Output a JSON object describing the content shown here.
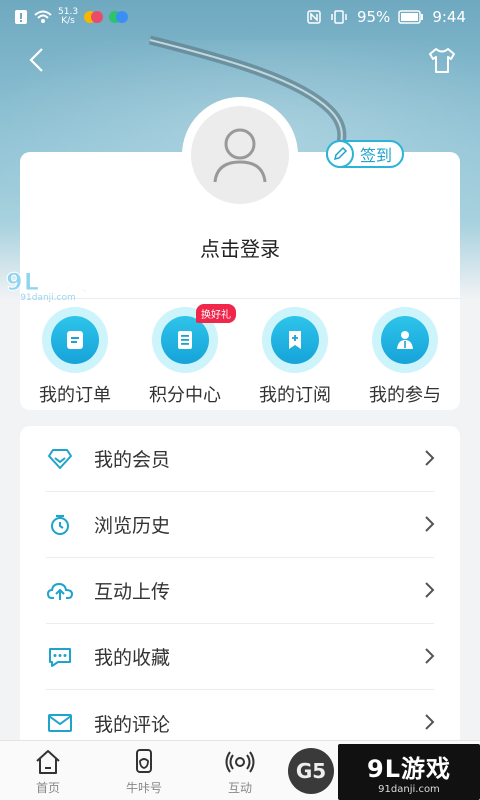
{
  "statusbar": {
    "net_speed_value": "51.3",
    "net_speed_unit": "K/s",
    "battery": "95%",
    "time": "9:44"
  },
  "profile": {
    "login_text": "点击登录",
    "signin_label": "签到"
  },
  "quick_actions": [
    {
      "label": "我的订单",
      "icon": "order-icon"
    },
    {
      "label": "积分中心",
      "icon": "points-icon",
      "badge": "换好礼"
    },
    {
      "label": "我的订阅",
      "icon": "subscription-icon"
    },
    {
      "label": "我的参与",
      "icon": "participation-icon"
    }
  ],
  "menu": [
    {
      "label": "我的会员",
      "icon": "diamond-icon"
    },
    {
      "label": "浏览历史",
      "icon": "clock-icon"
    },
    {
      "label": "互动上传",
      "icon": "cloud-upload-icon"
    },
    {
      "label": "我的收藏",
      "icon": "chat-icon"
    },
    {
      "label": "我的评论",
      "icon": "mail-icon"
    }
  ],
  "bottom_nav": [
    {
      "label": "首页",
      "icon": "home-icon"
    },
    {
      "label": "牛咔号",
      "icon": "bull-icon"
    },
    {
      "label": "互动",
      "icon": "broadcast-icon"
    }
  ],
  "watermark": {
    "brand": "9L游戏",
    "site": "91danji.com",
    "g5": "G5"
  },
  "colors": {
    "accent": "#1ea3cc",
    "badge": "#f0264a"
  }
}
